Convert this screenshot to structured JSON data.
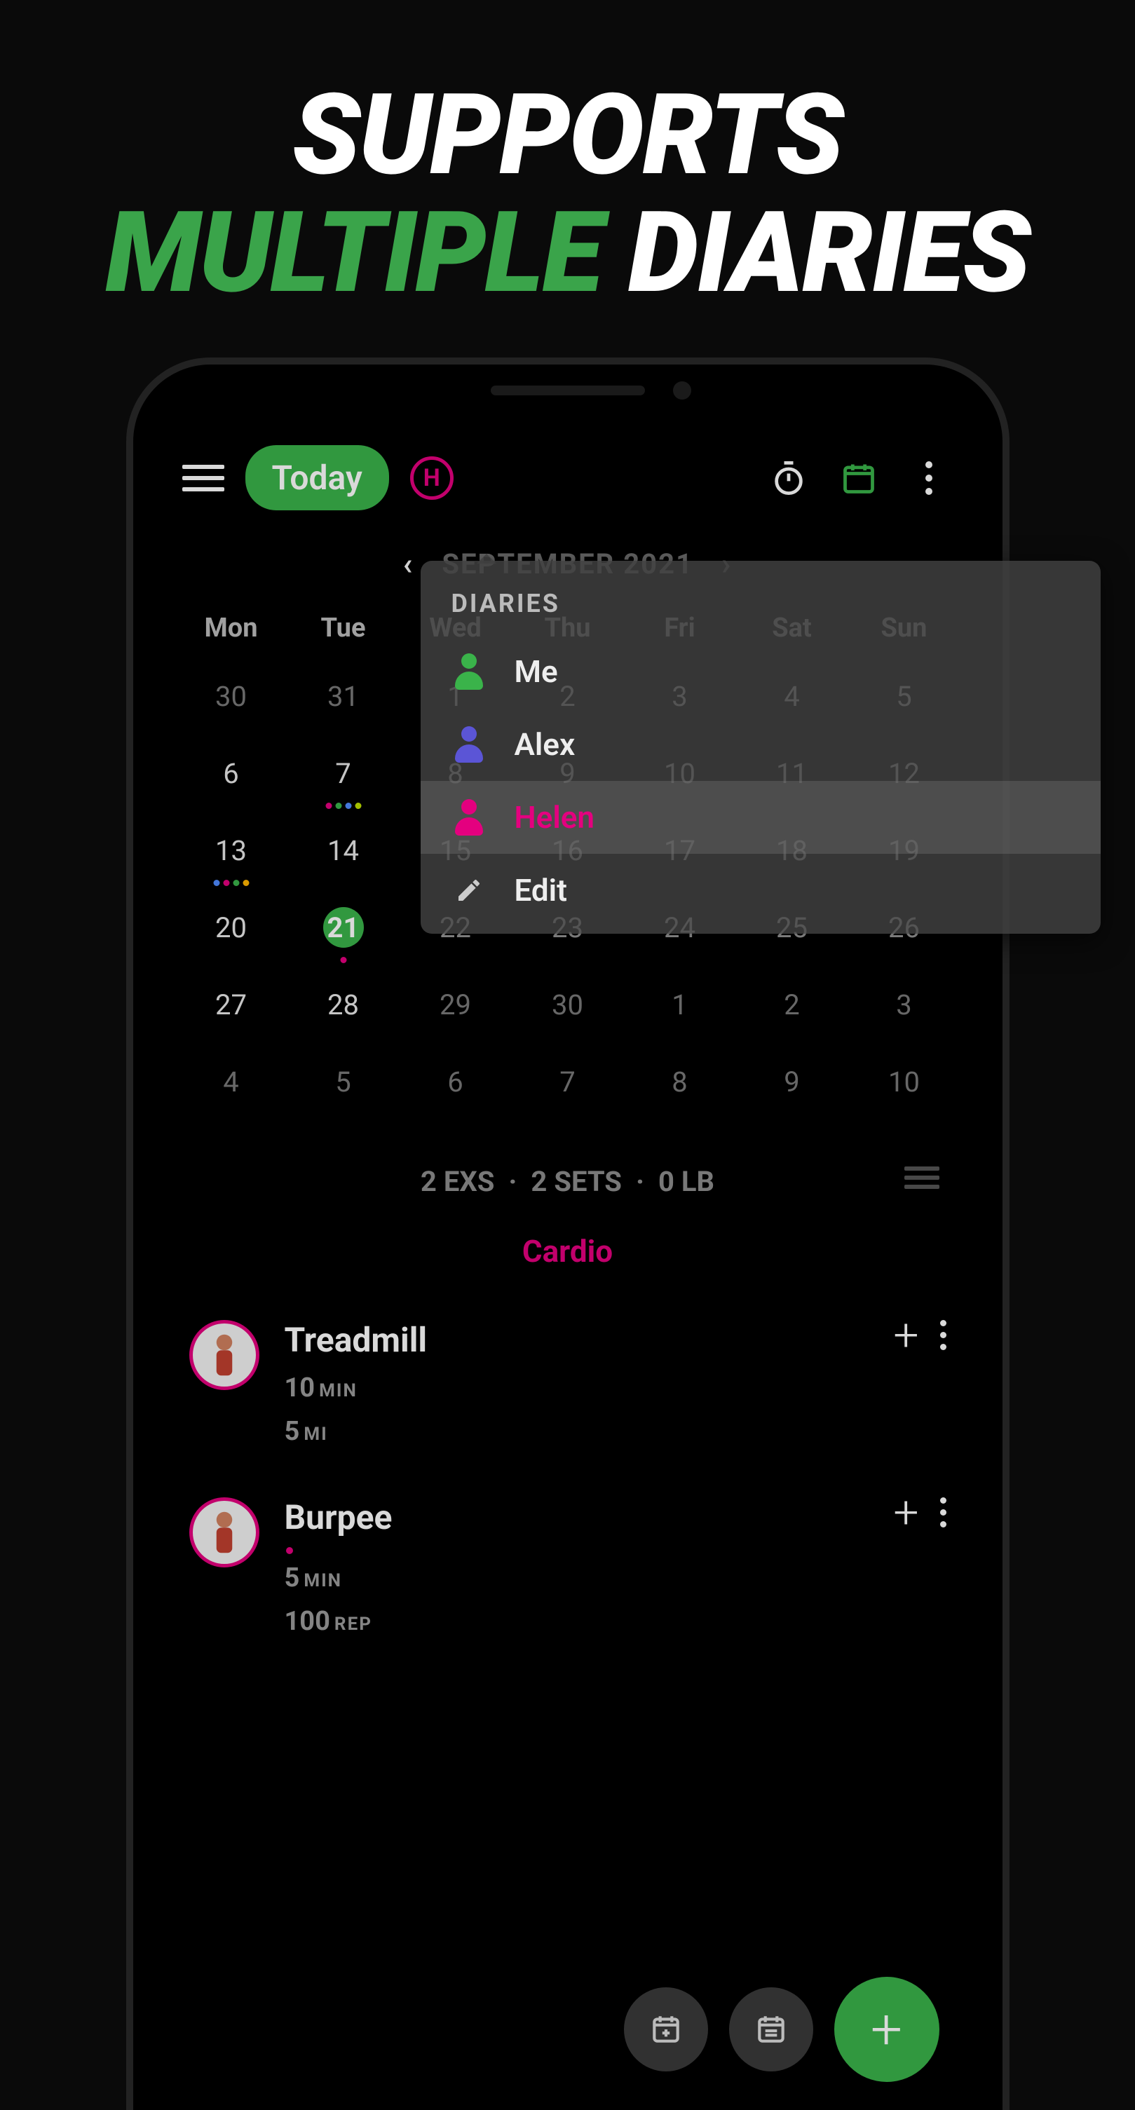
{
  "headline": {
    "line1": "SUPPORTS",
    "accent": "MULTIPLE",
    "rest": " DIARIES"
  },
  "appbar": {
    "today_label": "Today",
    "diary_initial": "H"
  },
  "month": {
    "label": "SEPTEMBER 2021"
  },
  "calendar": {
    "weekdays": [
      "Mon",
      "Tue",
      "Wed",
      "Thu",
      "Fri",
      "Sat",
      "Sun"
    ],
    "cells": [
      {
        "n": "30",
        "dim": true
      },
      {
        "n": "31",
        "dim": true
      },
      {
        "n": "1"
      },
      {
        "n": "2"
      },
      {
        "n": "3"
      },
      {
        "n": "4"
      },
      {
        "n": "5"
      },
      {
        "n": "6"
      },
      {
        "n": "7",
        "dots": [
          "#e4007f",
          "#3ab34a",
          "#4f8bff",
          "#c0e000"
        ]
      },
      {
        "n": "8"
      },
      {
        "n": "9"
      },
      {
        "n": "10"
      },
      {
        "n": "11"
      },
      {
        "n": "12"
      },
      {
        "n": "13",
        "dots": [
          "#4f8bff",
          "#e4007f",
          "#3ab34a",
          "#ffb400"
        ]
      },
      {
        "n": "14"
      },
      {
        "n": "15"
      },
      {
        "n": "16"
      },
      {
        "n": "17"
      },
      {
        "n": "18"
      },
      {
        "n": "19"
      },
      {
        "n": "20"
      },
      {
        "n": "21",
        "today": true,
        "dots": [
          "#e4007f"
        ]
      },
      {
        "n": "22"
      },
      {
        "n": "23"
      },
      {
        "n": "24"
      },
      {
        "n": "25"
      },
      {
        "n": "26"
      },
      {
        "n": "27"
      },
      {
        "n": "28"
      },
      {
        "n": "29",
        "dim": true
      },
      {
        "n": "30",
        "dim": true
      },
      {
        "n": "1",
        "dim": true
      },
      {
        "n": "2",
        "dim": true
      },
      {
        "n": "3",
        "dim": true
      },
      {
        "n": "4",
        "dim": true
      },
      {
        "n": "5",
        "dim": true
      },
      {
        "n": "6",
        "dim": true
      },
      {
        "n": "7",
        "dim": true
      },
      {
        "n": "8",
        "dim": true
      },
      {
        "n": "9",
        "dim": true
      },
      {
        "n": "10",
        "dim": true
      }
    ]
  },
  "summary": {
    "exs": "2 EXS",
    "sets": "2 SETS",
    "weight": "0 LB"
  },
  "category": "Cardio",
  "exercises": [
    {
      "title": "Treadmill",
      "line1_val": "10",
      "line1_unit": "MIN",
      "line2_val": "5",
      "line2_unit": "MI",
      "dot": false
    },
    {
      "title": "Burpee",
      "line1_val": "5",
      "line1_unit": "MIN",
      "line2_val": "100",
      "line2_unit": "REP",
      "dot": true
    }
  ],
  "popup": {
    "title": "DIARIES",
    "items": [
      {
        "label": "Me",
        "color": "#3ab34a",
        "type": "person"
      },
      {
        "label": "Alex",
        "color": "#5b55d6",
        "type": "person"
      },
      {
        "label": "Helen",
        "color": "#e4007f",
        "type": "person",
        "selected": true
      },
      {
        "label": "Edit",
        "type": "edit"
      }
    ]
  }
}
